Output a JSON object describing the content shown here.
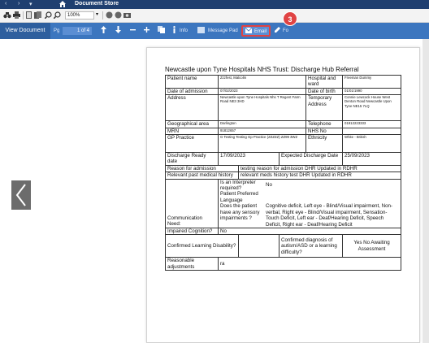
{
  "titlebar": {
    "nav_back": "‹",
    "nav_forward": "›",
    "menu_caret": "▾",
    "title": "Document Store"
  },
  "toolbar": {
    "zoom": "100%",
    "zoom_caret": "▾"
  },
  "actionbar": {
    "view_document": "View Document",
    "page_label": "Pg",
    "page_value": "1 of 4",
    "info": "Info",
    "message_pad": "Message Pad",
    "email": "Email",
    "extra": "Fo"
  },
  "annotation": {
    "step": "3"
  },
  "icons": {
    "home": "home-icon",
    "binoculars": "find-icon",
    "print": "print-icon",
    "zoom_in": "zoom-in-icon",
    "zoom_out": "zoom-out-icon",
    "arrow_up": "arrow-up-icon",
    "arrow_down": "arrow-down-icon",
    "minus": "minus-icon",
    "plus": "plus-icon",
    "info": "info-icon",
    "email": "email-icon",
    "edit": "edit-icon",
    "prev": "previous-page-icon"
  },
  "colors": {
    "titlebar": "#1f3f70",
    "actionbar": "#3c76bf",
    "highlight": "#e04343"
  },
  "document": {
    "title": "Newcastle upon Tyne Hospitals NHS Trust: Discharge Hub Referral",
    "patient_name_label": "Patient name",
    "patient_name": "Zzzfest, Malcolm",
    "hospital_ward_label": "Hospital and ward",
    "hospital_ward": "Freeman Dummy",
    "date_admission_label": "Date of admission",
    "date_admission": "07/02/2023",
    "dob_label": "Date of birth",
    "dob": "01/01/1990",
    "address_label": "Address",
    "address": "Newcastle upon Tyne Hospitals Nhs T Regent Farm Road NE3 3HD",
    "temp_address_label": "Temporary Address",
    "temp_address": "Connie Lewcock House West Denton Road Newcastle Upon Tyne NE15 7LQ",
    "geo_label": "Geographical area",
    "geo": "Darlington",
    "telephone_label": "Telephone",
    "telephone": "01912223333",
    "mrn_label": "MRN",
    "mrn": "91812657",
    "nhs_label": "NHS No",
    "nhs": "",
    "gp_label": "GP Practice",
    "gp": "G Testing Testing Gp Practice (ZZZZZ) ZZ99 3WZ",
    "ethnicity_label": "Ethnicity",
    "ethnicity": "White - British",
    "discharge_ready_label": "Discharge Ready date",
    "discharge_ready": "17/09/2023",
    "expected_discharge_label": "Expected Discharge Date",
    "expected_discharge": "25/09/2023",
    "reason_label": "Reason for admission",
    "reason": "testing reason for admission DHR Updated in RDHR",
    "pmh_label": "Relevant past medical history",
    "pmh": "relevant meds history test DHR Updated in RDHR",
    "comm_need_label": "Communication Need:",
    "interpreter_label": "Is an Interpreter required?",
    "interpreter": "No",
    "pref_lang_label": "Patient Preferred Language",
    "pref_lang": "",
    "sensory_label": "Does the patient have any sensory impairments ?",
    "sensory": "Cognitive deficit, Left eye - Blind/Visual impairment, Non-verbal, Right eye - Blind/Visual impairment, Sensation-Touch Deficit, Left ear - Deaf/Hearing Deficit, Speech Deficit, Right ear - Deaf/Hearing Deficit",
    "impaired_cog_label": "Impaired Cognition?",
    "impaired_cog": "No",
    "learning_disability_label": "Confirmed Learning Disability?",
    "learning_disability": "",
    "autism_label": "Confirmed diagnosis of autism/ASD or a learning difficulty?",
    "autism": "Yes No Awaiting Assessment",
    "reasonable_adj_label": "Reasonable adjustments",
    "reasonable_adj": "ra"
  }
}
